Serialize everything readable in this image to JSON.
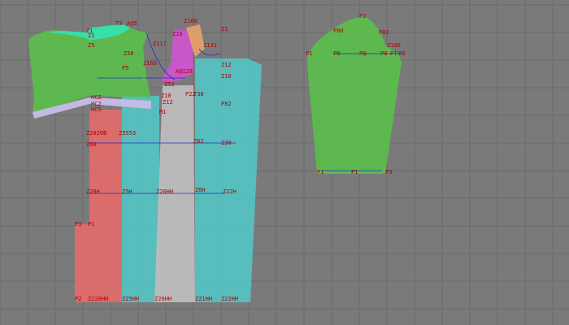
{
  "scene": {
    "background_color": "#7a7a7a",
    "grid_color": "#6a6a6a",
    "colors": {
      "green": "#5cbd4d",
      "cyan": "#55c1c1",
      "pink": "#e06b6b",
      "gray": "#bdbdbd",
      "magenta": "#cc55cc",
      "orange": "#e4a06a",
      "label": "#b00000",
      "blue": "#1a2fc8"
    }
  },
  "labels": {
    "front_bodice": {
      "z1": "Z1",
      "z1b": "Z1",
      "t3": "T3",
      "a": "A@5",
      "z50": "Z50",
      "z5": "Z5",
      "p5": "P5",
      "hcz": "HCZ",
      "hc2": "HC2",
      "hcs": "HC5"
    },
    "center": {
      "z160": "Z160",
      "z1b": "Z1",
      "z117": "Z117",
      "z16": "Z16",
      "z131": "Z131",
      "z10": "Z10",
      "z12": "Z12",
      "a128": "A@128",
      "t30": "T30",
      "z53": "Z53",
      "z10b": "Z10",
      "z12b": "Z12",
      "m1": "M1",
      "z160b": "Z160",
      "p82": "P82",
      "p22": "P22"
    },
    "skirt": {
      "z2020b": "Z2020B",
      "z5553": "Z5553",
      "z60": "Z60",
      "z30": "Z30",
      "z62": "Z62",
      "z20h": "Z20H",
      "z5h": "Z5H",
      "z20hh": "Z20HH",
      "z6h": "Z6H",
      "z22h": "Z22H",
      "p3": "P3",
      "p1": "P1",
      "p2": "P2",
      "z220hh": "Z220HH",
      "z25hh": "Z25HH",
      "z20hhb": "Z20HH",
      "z21hh": "Z21HH",
      "z22hh": "Z22HH"
    },
    "sleeve": {
      "p2": "P2",
      "p80": "P80",
      "p82": "P82",
      "p1": "P1",
      "p0": "P0",
      "pa": "P@",
      "p8": "P8",
      "pt": "PT",
      "p3": "P3",
      "z180": "Z180",
      "p1b": "P1",
      "p1c": "P1",
      "p3b": "P3"
    }
  }
}
